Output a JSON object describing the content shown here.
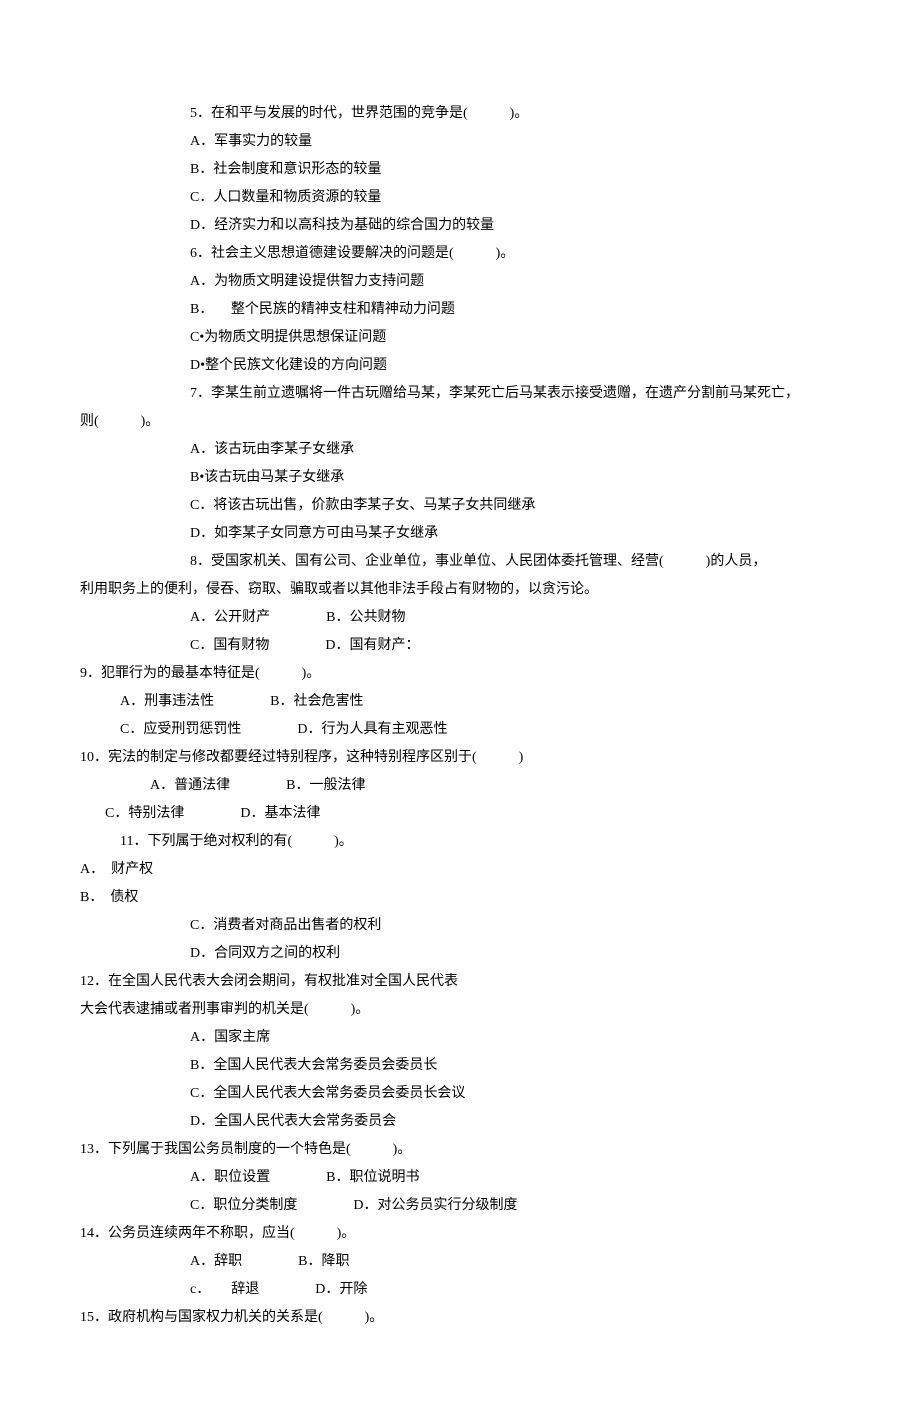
{
  "q5": {
    "stem": "5．在和平与发展的时代，世界范围的竞争是(　　　)。",
    "a": "A．军事实力的较量",
    "b": "B．社会制度和意识形态的较量",
    "c": "C．人口数量和物质资源的较量",
    "d": "D．经济实力和以高科技为基础的综合国力的较量"
  },
  "q6": {
    "stem": "6．社会主义思想道德建设要解决的问题是(　　　)。",
    "a": "A．为物质文明建设提供智力支持问题",
    "b": "B． 　整个民族的精神支柱和精神动力问题",
    "c": "C•为物质文明提供思想保证问题",
    "d": "D•整个民族文化建设的方向问题"
  },
  "q7": {
    "stem1": "7．李某生前立遗嘱将一件古玩赠给马某，李某死亡后马某表示接受遗赠，在遗产分割前马某死亡，",
    "stem2": "则(　　　)。",
    "a": "A．该古玩由李某子女继承",
    "b": "B•该古玩由马某子女继承",
    "c": "C．将该古玩出售，价款由李某子女、马某子女共同继承",
    "d": "D．如李某子女同意方可由马某子女继承"
  },
  "q8": {
    "stem1": "8．受国家机关、国有公司、企业单位，事业单位、人民团体委托管理、经营(　　　)的人员，",
    "stem2": "利用职务上的便利，侵吞、窃取、骗取或者以其他非法手段占有财物的，以贪污论。",
    "ab": "A．公开财产　　　　B．公共财物",
    "cd": "C．国有财物　　　　D．国有财产："
  },
  "q9": {
    "stem": "9．犯罪行为的最基本特征是(　　　)。",
    "ab": "A．刑事违法性　　　　B．社会危害性",
    "cd": "C．应受刑罚惩罚性　　　　D．行为人具有主观恶性"
  },
  "q10": {
    "stem": "10．宪法的制定与修改都要经过特别程序，这种特别程序区别于(　　　)",
    "ab": "A．普通法律　　　　B．一般法律",
    "cd": "C．特别法律　　　　D．基本法律"
  },
  "q11": {
    "stem": "11．下列属于绝对权利的有(　　　)。",
    "a": "A．　财产权",
    "b": "B．　债权",
    "c": "C．消费者对商品出售者的权利",
    "d": "D．合同双方之间的权利"
  },
  "q12": {
    "stem1": "12．在全国人民代表大会闭会期间，有权批准对全国人民代表",
    "stem2": "大会代表逮捕或者刑事审判的机关是(　　　)。",
    "a": "A．国家主席",
    "b": "B．全国人民代表大会常务委员会委员长",
    "c": "C．全国人民代表大会常务委员会委员长会议",
    "d": "D．全国人民代表大会常务委员会"
  },
  "q13": {
    "stem": "13．下列属于我国公务员制度的一个特色是(　　　)。",
    "ab": "A．职位设置　　　　B．职位说明书",
    "cd": "C．职位分类制度　　　　D．对公务员实行分级制度"
  },
  "q14": {
    "stem": "14．公务员连续两年不称职，应当(　　　)。",
    "ab": "A．辞职　　　　B．降职",
    "cd": "c．　　辞退　　　　D．开除"
  },
  "q15": {
    "stem": "15．政府机构与国家权力机关的关系是(　　　)。"
  }
}
